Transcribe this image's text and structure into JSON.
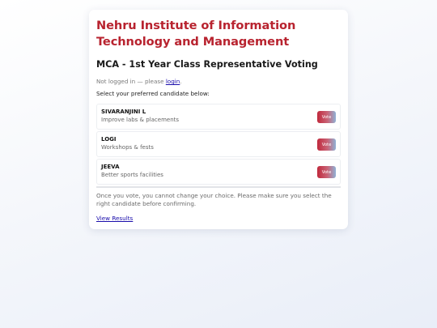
{
  "header": {
    "institute": "Nehru Institute of Information Technology and Management",
    "election_title": "MCA - 1st Year Class Representative Voting"
  },
  "auth": {
    "status_prefix": "Not logged in — please ",
    "login_link": "login",
    "status_suffix": "."
  },
  "instruction": "Select your preferred candidate below:",
  "candidates": [
    {
      "name": "SIVARANJINI L",
      "description": "Improve labs & placements",
      "vote_label": "Vote"
    },
    {
      "name": "LOGI",
      "description": "Workshops & fests",
      "vote_label": "Vote"
    },
    {
      "name": "JEEVA",
      "description": "Better sports facilities",
      "vote_label": "Vote"
    }
  ],
  "warning": "Once you vote, you cannot change your choice. Please make sure you select the right candidate before confirming.",
  "results_link": "View Results",
  "colors": {
    "title_red": "#b8232f",
    "link_blue": "#1a0dab",
    "vote_gradient_start": "#c0293c",
    "vote_gradient_end": "#8fb2d6"
  }
}
